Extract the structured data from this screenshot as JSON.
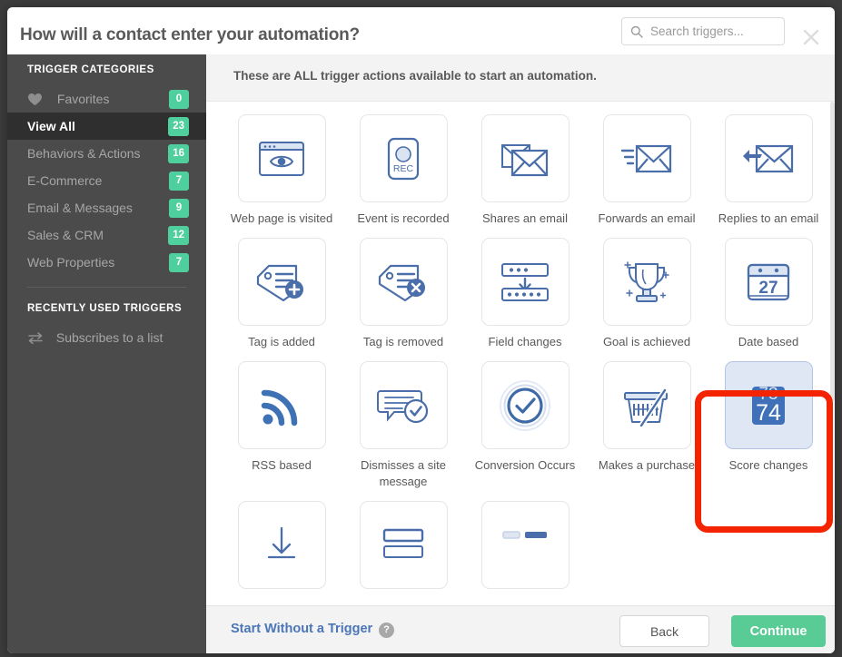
{
  "header": {
    "title": "How will a contact enter your automation?",
    "search_placeholder": "Search triggers...",
    "search_value": "",
    "search_icon": "search-icon",
    "close_icon": "close-icon"
  },
  "sidebar": {
    "categories_heading": "TRIGGER CATEGORIES",
    "items": [
      {
        "label": "Favorites",
        "count": "0",
        "icon": "heart-icon",
        "active": false
      },
      {
        "label": "View All",
        "count": "23",
        "icon": "",
        "active": true
      },
      {
        "label": "Behaviors & Actions",
        "count": "16",
        "icon": "",
        "active": false
      },
      {
        "label": "E-Commerce",
        "count": "7",
        "icon": "",
        "active": false
      },
      {
        "label": "Email & Messages",
        "count": "9",
        "icon": "",
        "active": false
      },
      {
        "label": "Sales & CRM",
        "count": "12",
        "icon": "",
        "active": false
      },
      {
        "label": "Web Properties",
        "count": "7",
        "icon": "",
        "active": false
      }
    ],
    "recent_heading": "RECENTLY USED TRIGGERS",
    "recent_items": [
      {
        "label": "Subscribes to a list",
        "icon": "swap-arrows-icon"
      }
    ]
  },
  "main": {
    "subtitle": "These are ALL trigger actions available to start an automation.",
    "triggers": [
      {
        "label": "Web page is visited",
        "icon": "browser-eye-icon",
        "selected": false
      },
      {
        "label": "Event is recorded",
        "icon": "rec-button-icon",
        "selected": false
      },
      {
        "label": "Shares an email",
        "icon": "share-envelope-icon",
        "selected": false
      },
      {
        "label": "Forwards an email",
        "icon": "forward-envelope-icon",
        "selected": false
      },
      {
        "label": "Replies to an email",
        "icon": "reply-envelope-icon",
        "selected": false
      },
      {
        "label": "Tag is added",
        "icon": "tag-plus-icon",
        "selected": false
      },
      {
        "label": "Tag is removed",
        "icon": "tag-remove-icon",
        "selected": false
      },
      {
        "label": "Field changes",
        "icon": "field-change-icon",
        "selected": false
      },
      {
        "label": "Goal is achieved",
        "icon": "trophy-icon",
        "selected": false
      },
      {
        "label": "Date based",
        "icon": "calendar-icon",
        "calendar_day": "27",
        "selected": false
      },
      {
        "label": "RSS based",
        "icon": "rss-icon",
        "selected": false
      },
      {
        "label": "Dismisses a site message",
        "icon": "site-message-check-icon",
        "selected": false
      },
      {
        "label": "Conversion Occurs",
        "icon": "conversion-check-icon",
        "selected": false
      },
      {
        "label": "Makes a purchase",
        "icon": "shopping-basket-icon",
        "selected": false
      },
      {
        "label": "Score changes",
        "icon": "score-counter-icon",
        "score_prev": "73",
        "score_next": "74",
        "selected": true
      },
      {
        "label": "",
        "icon": "download-arrow-icon",
        "selected": false
      },
      {
        "label": "",
        "icon": "form-icon",
        "selected": false
      },
      {
        "label": "",
        "icon": "misc-icon",
        "selected": false
      }
    ]
  },
  "footer": {
    "start_without_trigger": "Start Without a Trigger",
    "help_icon_label": "?",
    "back_label": "Back",
    "continue_label": "Continue"
  },
  "colors": {
    "badge_green": "#4ecf9d",
    "continue_green": "#59cc96",
    "icon_blue": "#4a6ea9",
    "link_blue": "#4a76b8",
    "annotation_red": "#f52400",
    "sidebar_bg": "#4b4b4b",
    "sidebar_active_bg": "#2f2f2f"
  }
}
